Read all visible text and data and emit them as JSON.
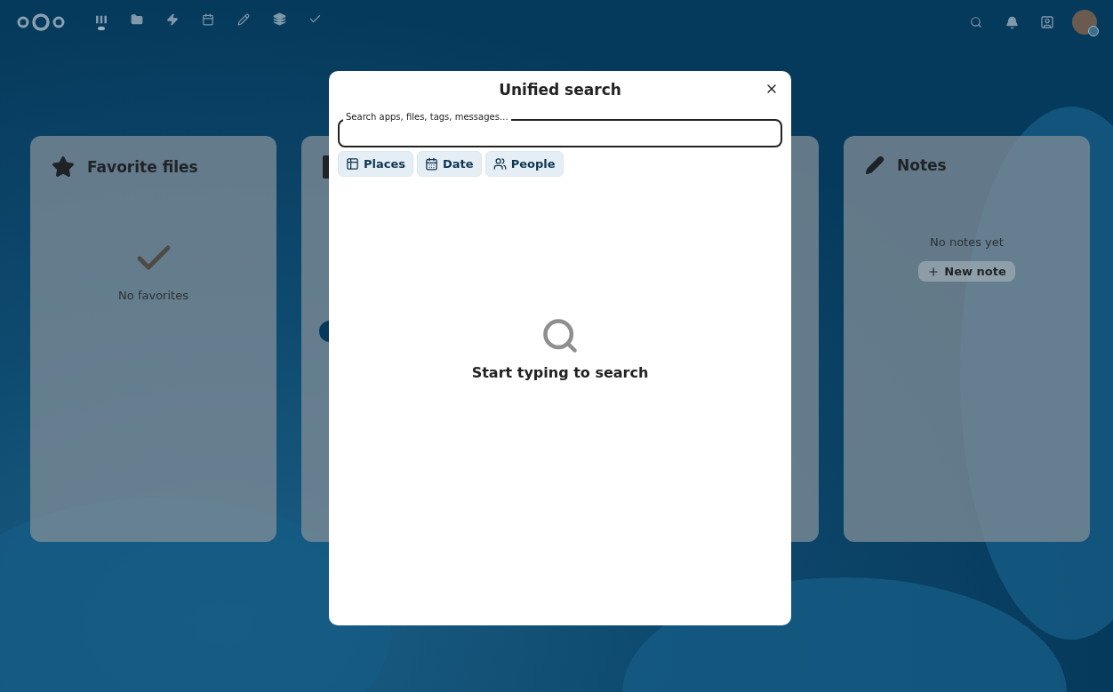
{
  "header": {
    "apps": [
      {
        "selected": true
      },
      {
        "selected": false
      },
      {
        "selected": false
      },
      {
        "selected": false
      },
      {
        "selected": false
      },
      {
        "selected": false
      },
      {
        "selected": false
      }
    ]
  },
  "widgets": [
    {
      "kind": "favorites",
      "title": "Favorite files",
      "empty_text": "No favorites"
    },
    {
      "kind": "hidden"
    },
    {
      "kind": "hidden"
    },
    {
      "kind": "notes",
      "title": "Notes",
      "empty_text": "No notes yet",
      "button": "New note"
    }
  ],
  "dialog": {
    "title": "Unified search",
    "search": {
      "label": "Search apps, files, tags, messages…"
    },
    "filters": [
      {
        "label": "Places"
      },
      {
        "label": "Date"
      },
      {
        "label": "People"
      }
    ],
    "empty_state": "Start typing to search"
  }
}
